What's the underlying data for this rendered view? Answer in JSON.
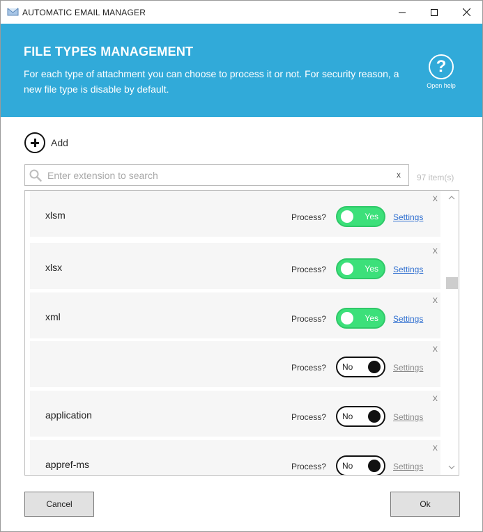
{
  "window": {
    "title": "AUTOMATIC EMAIL MANAGER"
  },
  "banner": {
    "title": "FILE TYPES MANAGEMENT",
    "description": "For each type of attachment you can choose to process it or not. For security reason, a new file type is disable by default.",
    "help_label": "Open help",
    "help_glyph": "?"
  },
  "toolbar": {
    "add_label": "Add"
  },
  "search": {
    "placeholder": "Enter extension to search",
    "value": "",
    "clear_label": "x"
  },
  "item_count": "97  item(s)",
  "labels": {
    "process": "Process?",
    "settings": "Settings",
    "remove": "X"
  },
  "items": [
    {
      "ext": "xlsm",
      "enabled": true,
      "toggle_label": "Yes"
    },
    {
      "ext": "xlsx",
      "enabled": true,
      "toggle_label": "Yes"
    },
    {
      "ext": "xml",
      "enabled": true,
      "toggle_label": "Yes"
    },
    {
      "ext": "",
      "enabled": false,
      "toggle_label": "No"
    },
    {
      "ext": "application",
      "enabled": false,
      "toggle_label": "No"
    },
    {
      "ext": "appref-ms",
      "enabled": false,
      "toggle_label": "No"
    }
  ],
  "footer": {
    "cancel_label": "Cancel",
    "ok_label": "Ok"
  },
  "colors": {
    "banner": "#31aad9",
    "toggle_on": "#3ce07a",
    "toggle_off_knob": "#111111",
    "settings_link": "#2f6fd0"
  }
}
